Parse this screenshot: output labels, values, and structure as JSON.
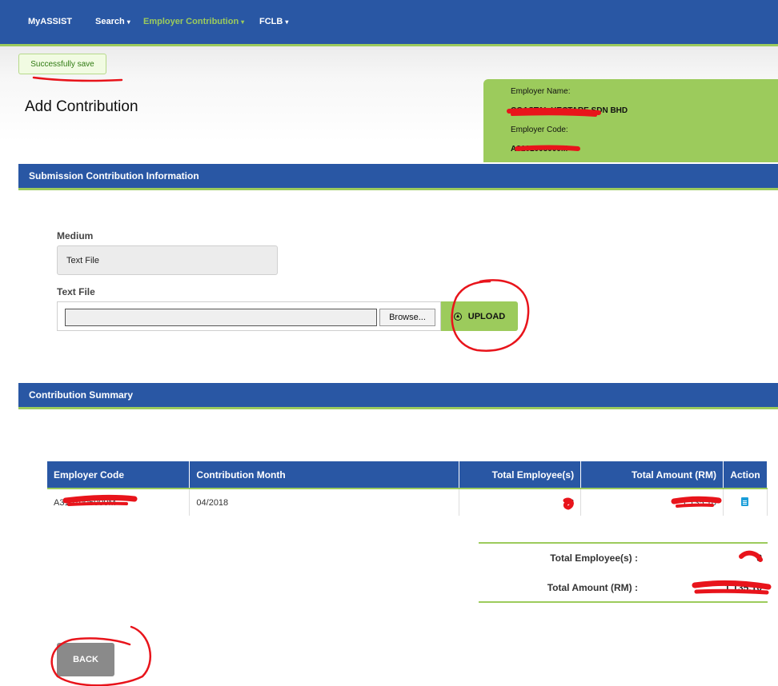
{
  "nav": {
    "brand": "MyASSIST",
    "items": [
      {
        "label": "Search",
        "active": false
      },
      {
        "label": "Employer Contribution",
        "active": true
      },
      {
        "label": "FCLB",
        "active": false
      }
    ]
  },
  "alert": {
    "message": "Successfully save"
  },
  "page": {
    "title": "Add Contribution"
  },
  "employer": {
    "name_label": "Employer Name:",
    "name_value": "COASTAL HECTARE SDN BHD",
    "code_label": "Employer Code:",
    "code_value": "A3101005000M"
  },
  "submission": {
    "header": "Submission Contribution Information",
    "medium_label": "Medium",
    "medium_value": "Text File",
    "textfile_label": "Text File",
    "browse_label": "Browse...",
    "upload_label": "UPLOAD"
  },
  "summary": {
    "header": "Contribution Summary",
    "columns": [
      "Employer Code",
      "Contribution Month",
      "Total Employee(s)",
      "Total Amount (RM)",
      "Action"
    ],
    "rows": [
      {
        "employer_code": "A3101005000M",
        "month": "04/2018",
        "total_employees": "8",
        "total_amount": "1,135.10"
      }
    ],
    "total_employees_label": "Total Employee(s) :",
    "total_employees_value": "8",
    "total_amount_label": "Total Amount (RM) :",
    "total_amount_value": "1,135.10"
  },
  "back_label": "BACK",
  "colors": {
    "primary": "#2957a4",
    "accent": "#9ccb5c",
    "annotation": "#e8141b"
  },
  "icons": {
    "upload": "upload-circle-icon",
    "action": "document-icon",
    "caret": "caret-down-icon"
  }
}
